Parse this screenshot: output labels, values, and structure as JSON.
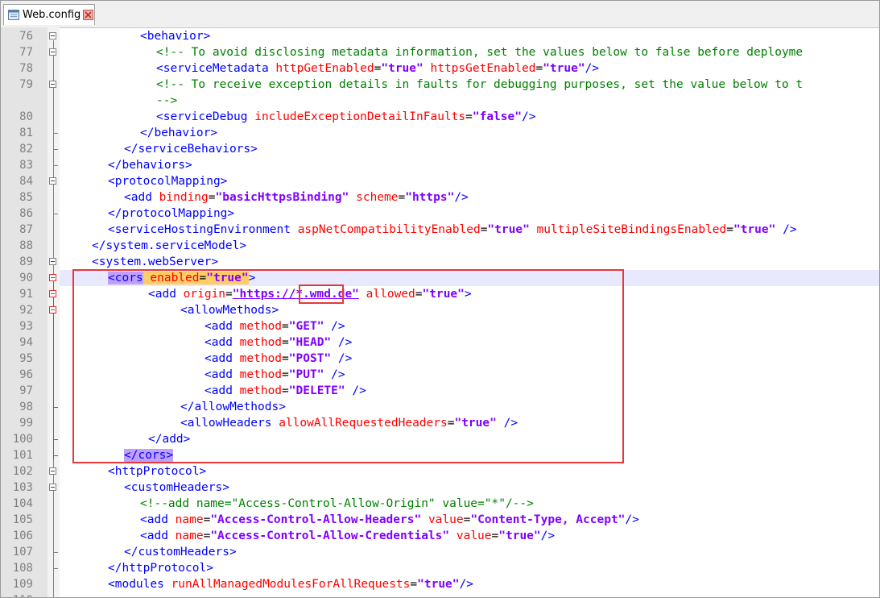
{
  "tab": {
    "title": "Web.config",
    "file_icon": "file-icon",
    "close_icon": "close-icon"
  },
  "colors": {
    "tag": "#0000ff",
    "attribute": "#ff0000",
    "value": "#8000ff",
    "comment": "#008000",
    "annotation": "#e53939",
    "current_line": "#e8e8ff"
  },
  "lines": [
    {
      "num": "76",
      "indent": 4,
      "html": "<span class=\"b\">&lt;behavior&gt;</span>"
    },
    {
      "num": "77",
      "indent": 5,
      "html": "<span class=\"c\">&lt;!-- To avoid disclosing metadata information, set the values below to false before deployme</span>"
    },
    {
      "num": "78",
      "indent": 5,
      "html": "<span class=\"b\">&lt;serviceMetadata </span><span class=\"a\">httpGetEnabled</span><span class=\"q\">=</span><span class=\"v\">\"true\"</span><span class=\"a\"> httpsGetEnabled</span><span class=\"q\">=</span><span class=\"v\">\"true\"</span><span class=\"b\">/&gt;</span>"
    },
    {
      "num": "79",
      "indent": 5,
      "html": "<span class=\"c\">&lt;!-- To receive exception details in faults for debugging purposes, set the value below to t</span>"
    },
    {
      "num": "",
      "indent": 5,
      "html": "<span class=\"c\">--&gt;</span>"
    },
    {
      "num": "80",
      "indent": 5,
      "html": "<span class=\"b\">&lt;serviceDebug </span><span class=\"a\">includeExceptionDetailInFaults</span><span class=\"q\">=</span><span class=\"v\">\"false\"</span><span class=\"b\">/&gt;</span>"
    },
    {
      "num": "81",
      "indent": 4,
      "html": "<span class=\"b\">&lt;/behavior&gt;</span>"
    },
    {
      "num": "82",
      "indent": 3,
      "html": "<span class=\"b\">&lt;/serviceBehaviors&gt;</span>"
    },
    {
      "num": "83",
      "indent": 2,
      "html": "<span class=\"b\">&lt;/behaviors&gt;</span>"
    },
    {
      "num": "84",
      "indent": 2,
      "html": "<span class=\"b\">&lt;protocolMapping&gt;</span>"
    },
    {
      "num": "85",
      "indent": 3,
      "html": "<span class=\"b\">&lt;add </span><span class=\"a\">binding</span><span class=\"q\">=</span><span class=\"v\">\"basicHttpsBinding\"</span><span class=\"a\"> scheme</span><span class=\"q\">=</span><span class=\"v\">\"https\"</span><span class=\"b\">/&gt;</span>"
    },
    {
      "num": "86",
      "indent": 2,
      "html": "<span class=\"b\">&lt;/protocolMapping&gt;</span>"
    },
    {
      "num": "87",
      "indent": 2,
      "html": "<span class=\"b\">&lt;serviceHostingEnvironment </span><span class=\"a\">aspNetCompatibilityEnabled</span><span class=\"q\">=</span><span class=\"v\">\"true\"</span><span class=\"a\"> multipleSiteBindingsEnabled</span><span class=\"q\">=</span><span class=\"v\">\"true\"</span><span class=\"b\"> /&gt;</span>"
    },
    {
      "num": "88",
      "indent": 1,
      "html": "<span class=\"b\">&lt;/system.serviceModel&gt;</span>"
    },
    {
      "num": "89",
      "indent": 1,
      "html": "<span class=\"b\">&lt;system.webServer&gt;</span>"
    },
    {
      "num": "90",
      "indent": 2,
      "html": "<span class=\"b mt\">&lt;</span><span class=\"b mt\">cors</span><span class=\"a mk\"> enabled</span><span class=\"q mk\">=</span><span class=\"v mk\">\"true\"</span><span class=\"b\">&gt;</span>"
    },
    {
      "num": "91",
      "indent": 4.5,
      "html": "<span class=\"b\">&lt;add </span><span class=\"a\">origin</span><span class=\"q\">=</span><span class=\"v u\">\"https://*.wmd.de\"</span><span class=\"a\"> allowed</span><span class=\"q\">=</span><span class=\"v\">\"true\"</span><span class=\"b\">&gt;</span>"
    },
    {
      "num": "92",
      "indent": 6.5,
      "html": "<span class=\"b\">&lt;allowMethods&gt;</span>"
    },
    {
      "num": "93",
      "indent": 8,
      "html": "<span class=\"b\">&lt;add </span><span class=\"a\">method</span><span class=\"q\">=</span><span class=\"v\">\"GET\"</span><span class=\"b\"> /&gt;</span>"
    },
    {
      "num": "94",
      "indent": 8,
      "html": "<span class=\"b\">&lt;add </span><span class=\"a\">method</span><span class=\"q\">=</span><span class=\"v\">\"HEAD\"</span><span class=\"b\"> /&gt;</span>"
    },
    {
      "num": "95",
      "indent": 8,
      "html": "<span class=\"b\">&lt;add </span><span class=\"a\">method</span><span class=\"q\">=</span><span class=\"v\">\"POST\"</span><span class=\"b\"> /&gt;</span>"
    },
    {
      "num": "96",
      "indent": 8,
      "html": "<span class=\"b\">&lt;add </span><span class=\"a\">method</span><span class=\"q\">=</span><span class=\"v\">\"PUT\"</span><span class=\"b\"> /&gt;</span>"
    },
    {
      "num": "97",
      "indent": 8,
      "html": "<span class=\"b\">&lt;add </span><span class=\"a\">method</span><span class=\"q\">=</span><span class=\"v\">\"DELETE\"</span><span class=\"b\"> /&gt;</span>"
    },
    {
      "num": "98",
      "indent": 6.5,
      "html": "<span class=\"b\">&lt;/allowMethods&gt;</span>"
    },
    {
      "num": "99",
      "indent": 6.5,
      "html": "<span class=\"b\">&lt;allowHeaders </span><span class=\"a\">allowAllRequestedHeaders</span><span class=\"q\">=</span><span class=\"v\">\"true\"</span><span class=\"b\"> /&gt;</span>"
    },
    {
      "num": "100",
      "indent": 4.5,
      "html": "<span class=\"b\">&lt;/add&gt;</span>"
    },
    {
      "num": "101",
      "indent": 3,
      "html": "<span class=\"b mt\">&lt;/cors&gt;</span>"
    },
    {
      "num": "102",
      "indent": 2,
      "html": "<span class=\"b\">&lt;httpProtocol&gt;</span>"
    },
    {
      "num": "103",
      "indent": 3,
      "html": "<span class=\"b\">&lt;customHeaders&gt;</span>"
    },
    {
      "num": "104",
      "indent": 4,
      "html": "<span class=\"c\">&lt;!--add name=\"Access-Control-Allow-Origin\" value=\"*\"/--&gt;</span>"
    },
    {
      "num": "105",
      "indent": 4,
      "html": "<span class=\"b\">&lt;add </span><span class=\"a\">name</span><span class=\"q\">=</span><span class=\"v\">\"Access-Control-Allow-Headers\"</span><span class=\"a\"> value</span><span class=\"q\">=</span><span class=\"v\">\"Content-Type, Accept\"</span><span class=\"b\">/&gt;</span>"
    },
    {
      "num": "106",
      "indent": 4,
      "html": "<span class=\"b\">&lt;add </span><span class=\"a\">name</span><span class=\"q\">=</span><span class=\"v\">\"Access-Control-Allow-Credentials\"</span><span class=\"a\"> value</span><span class=\"q\">=</span><span class=\"v\">\"true\"</span><span class=\"b\">/&gt;</span>"
    },
    {
      "num": "107",
      "indent": 3,
      "html": "<span class=\"b\">&lt;/customHeaders&gt;</span>"
    },
    {
      "num": "108",
      "indent": 2,
      "html": "<span class=\"b\">&lt;/httpProtocol&gt;</span>"
    },
    {
      "num": "109",
      "indent": 2,
      "html": "<span class=\"b\">&lt;modules </span><span class=\"a\">runAllManagedModulesForAllRequests</span><span class=\"q\">=</span><span class=\"v\">\"true\"</span><span class=\"b\">/&gt;</span>"
    },
    {
      "num": "110",
      "indent": 2,
      "html": ""
    }
  ]
}
